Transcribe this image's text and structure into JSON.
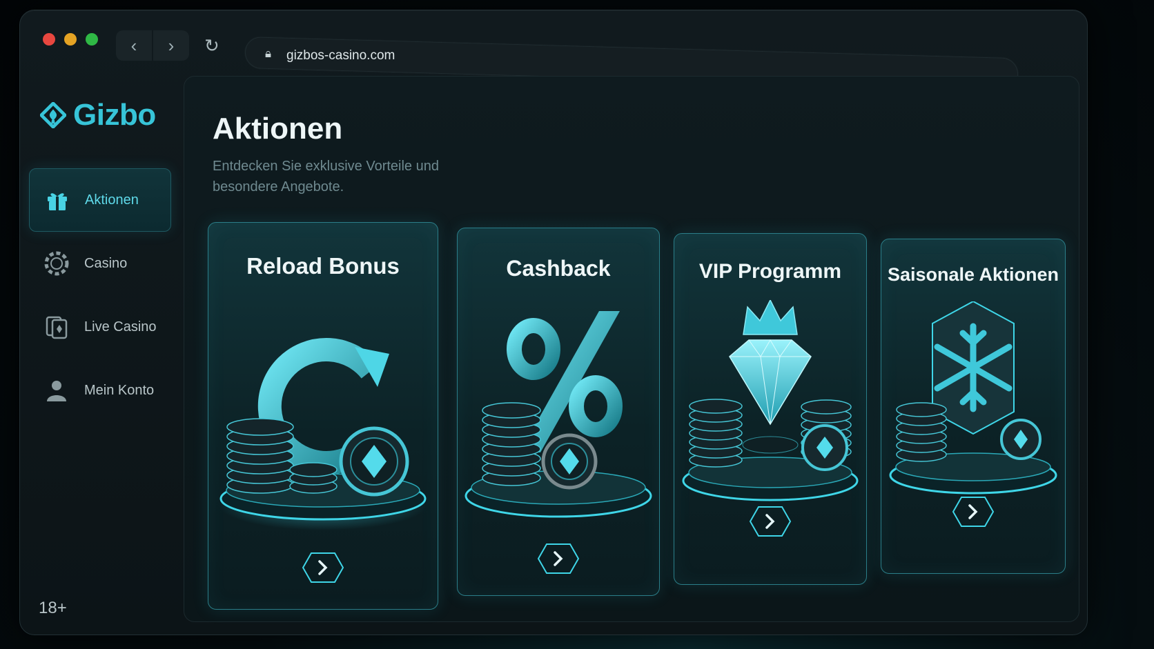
{
  "browser": {
    "url": "gizbos-casino.com",
    "back_icon": "chevron-left-icon",
    "forward_icon": "chevron-right-icon"
  },
  "brand": {
    "name": "Gizbo",
    "accent": "#37c4d8"
  },
  "sidebar": {
    "items": [
      {
        "label": "Aktionen",
        "icon": "gift-icon",
        "active": true
      },
      {
        "label": "Casino",
        "icon": "chip-icon",
        "active": false
      },
      {
        "label": "Live Casino",
        "icon": "cards-icon",
        "active": false
      },
      {
        "label": "Mein Konto",
        "icon": "user-icon",
        "active": false
      }
    ],
    "age_badge": "18+"
  },
  "main": {
    "title": "Aktionen",
    "subtitle": "Entdecken Sie exklusive Vorteile und besondere Angebote."
  },
  "cards": [
    {
      "title": "Reload Bonus",
      "icon": "reload-icon"
    },
    {
      "title": "Cashback",
      "icon": "percent-icon"
    },
    {
      "title": "VIP Programm",
      "icon": "diamond-crown-icon"
    },
    {
      "title": "Saisonale Aktionen",
      "icon": "snowflake-icon"
    }
  ]
}
